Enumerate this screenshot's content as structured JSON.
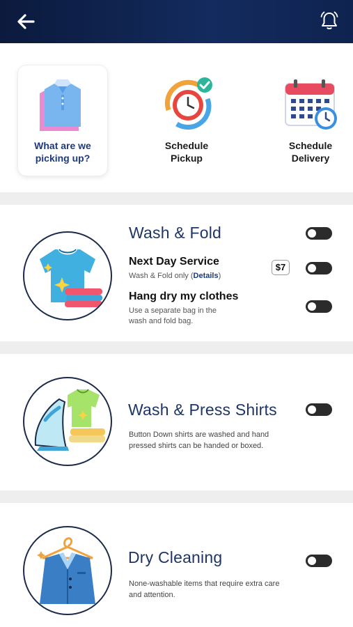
{
  "header": {
    "back_icon": "arrow-left-icon",
    "bell_icon": "bell-icon",
    "bg_color": "#0f2350"
  },
  "steps": [
    {
      "label_line1": "What are we",
      "label_line2": "picking up?",
      "icon": "shirt-icon"
    },
    {
      "label_line1": "Schedule",
      "label_line2": "Pickup",
      "icon": "clock-icon"
    },
    {
      "label_line1": "Schedule",
      "label_line2": "Delivery",
      "icon": "calendar-icon"
    }
  ],
  "services": {
    "wash_fold": {
      "title": "Wash & Fold",
      "icon": "tshirt-icon",
      "next_day": {
        "title": "Next Day Service",
        "sub_prefix": "Wash & Fold only (",
        "sub_link": "Details",
        "sub_suffix": ")",
        "price": "$7"
      },
      "hang_dry": {
        "title": "Hang dry my clothes",
        "sub_line1": "Use a separate bag in the",
        "sub_line2": "wash and fold bag."
      }
    },
    "wash_press": {
      "title": "Wash & Press Shirts",
      "icon": "iron-icon",
      "desc_line1": "Button Down shirts are washed and hand",
      "desc_line2": "pressed shirts can be handed or boxed."
    },
    "dry_cleaning": {
      "title": "Dry Cleaning",
      "icon": "suit-hanger-icon",
      "desc_line1": "None-washable items that require extra care",
      "desc_line2": "and attention."
    }
  },
  "colors": {
    "accent": "#1d3a7a",
    "toggle_off": "#2b2b2b",
    "divider": "#eeeeef"
  }
}
